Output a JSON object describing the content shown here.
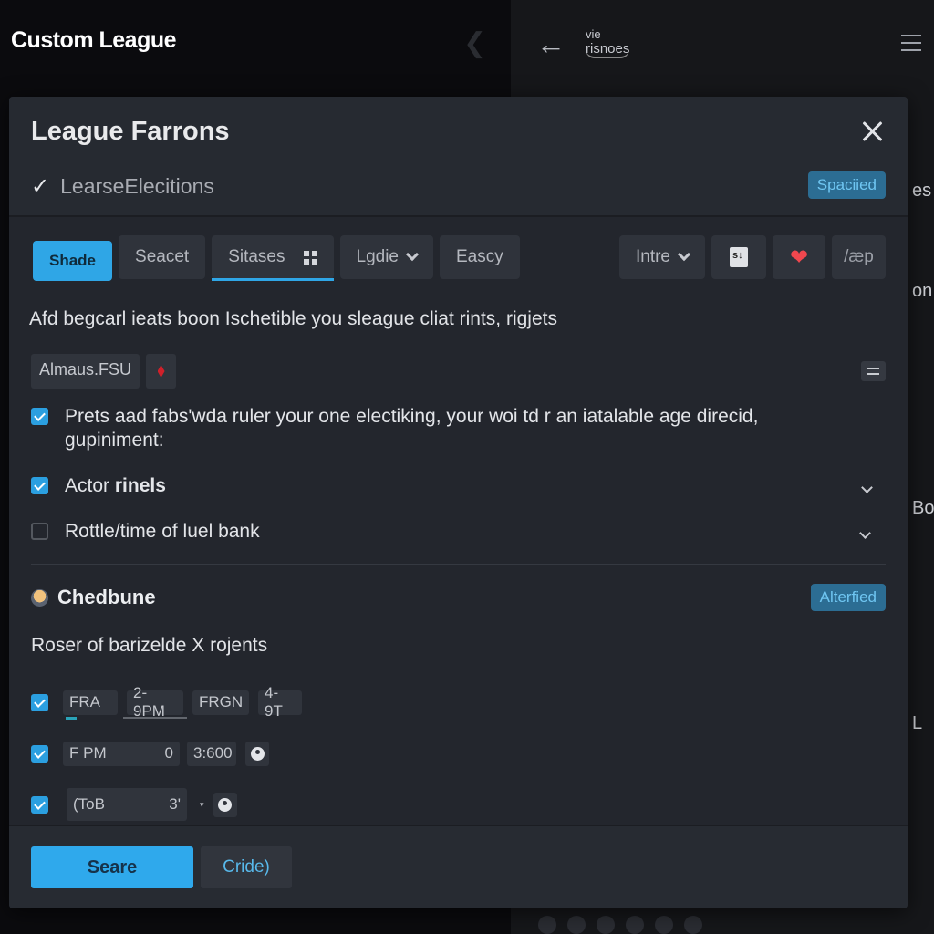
{
  "app": {
    "title": "Custom League",
    "brand_line1": "vie",
    "brand_line2": "risnoes",
    "right_fragments": [
      "es",
      "on",
      "Bo",
      "L"
    ]
  },
  "modal": {
    "title": "League Farrons",
    "subtitle": "LearseElecitions",
    "status_badge": "Spaciied",
    "toolbar": {
      "buttons": [
        "Shade",
        "Seacet",
        "Sitases",
        "Lgdie",
        "Eascy"
      ],
      "right_buttons": [
        "Intre"
      ],
      "icon_buttons": [
        "document-icon",
        "heart-icon",
        "slash-icon"
      ],
      "slash_label": "/æp",
      "active_tab": "Sitases"
    },
    "description": "Afd begcarl ieats boon Ischetible you sleague cliat rints, rigjets",
    "chip": "Almaus.FSU",
    "options": [
      {
        "label": "Prets aad fabs'wda ruler your one electiking, your woi td r an iatalable age direcid, gupiniment:",
        "checked": true
      },
      {
        "label_normal": "Actor ",
        "label_bold": "rinels",
        "checked": true
      },
      {
        "label": "Rottle/time of luel bank",
        "checked": false
      }
    ],
    "section": {
      "title": "Chedbune",
      "badge": "Alterfied",
      "description": "Roser of barizelde X rojents"
    },
    "schedule": [
      {
        "checked": true,
        "fields": [
          "FRA",
          "2-9PM",
          "FRGN",
          "4-9T"
        ]
      },
      {
        "checked": true,
        "field1": "F PM",
        "field1_value": "0",
        "field2": "3:600"
      },
      {
        "checked": true,
        "field1": "(ToB",
        "field1_value": "3'",
        "marker": "▾"
      }
    ],
    "footer": {
      "save_label": "Seare",
      "cancel_label": "Cride)"
    }
  }
}
